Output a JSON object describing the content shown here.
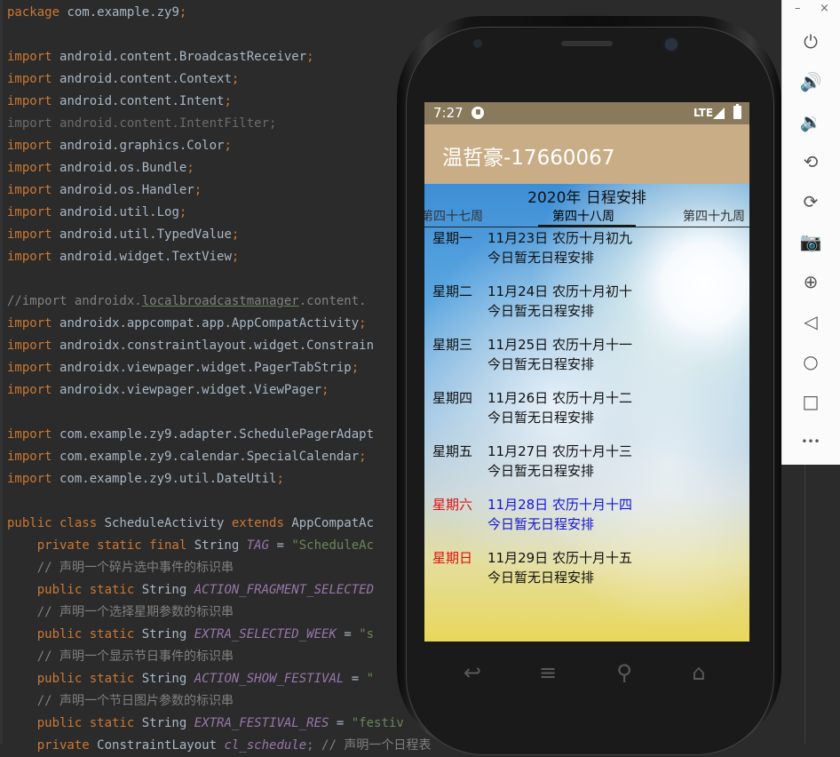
{
  "editor": {
    "lines": [
      [
        {
          "t": "package ",
          "c": "kw"
        },
        {
          "t": "com.example.zy9",
          "c": "typ"
        },
        {
          "t": ";",
          "c": "kw"
        }
      ],
      [],
      [
        {
          "t": "import ",
          "c": "kw"
        },
        {
          "t": "android.content.BroadcastReceiver",
          "c": "typ"
        },
        {
          "t": ";",
          "c": "kw"
        }
      ],
      [
        {
          "t": "import ",
          "c": "kw"
        },
        {
          "t": "android.content.Context",
          "c": "typ"
        },
        {
          "t": ";",
          "c": "kw"
        }
      ],
      [
        {
          "t": "import ",
          "c": "kw"
        },
        {
          "t": "android.content.Intent",
          "c": "typ"
        },
        {
          "t": ";",
          "c": "kw"
        }
      ],
      [
        {
          "t": "import android.content.IntentFilter;",
          "c": "dim"
        }
      ],
      [
        {
          "t": "import ",
          "c": "kw"
        },
        {
          "t": "android.graphics.Color",
          "c": "typ"
        },
        {
          "t": ";",
          "c": "kw"
        }
      ],
      [
        {
          "t": "import ",
          "c": "kw"
        },
        {
          "t": "android.os.Bundle",
          "c": "typ"
        },
        {
          "t": ";",
          "c": "kw"
        }
      ],
      [
        {
          "t": "import ",
          "c": "kw"
        },
        {
          "t": "android.os.Handler",
          "c": "typ"
        },
        {
          "t": ";",
          "c": "kw"
        }
      ],
      [
        {
          "t": "import ",
          "c": "kw"
        },
        {
          "t": "android.util.Log",
          "c": "typ"
        },
        {
          "t": ";",
          "c": "kw"
        }
      ],
      [
        {
          "t": "import ",
          "c": "kw"
        },
        {
          "t": "android.util.TypedValue",
          "c": "typ"
        },
        {
          "t": ";",
          "c": "kw"
        }
      ],
      [
        {
          "t": "import ",
          "c": "kw"
        },
        {
          "t": "android.widget.TextView",
          "c": "typ"
        },
        {
          "t": ";",
          "c": "kw"
        }
      ],
      [],
      [
        {
          "t": "//import androidx.",
          "c": "cmt"
        },
        {
          "t": "localbroadcastmanager",
          "c": "cmt ul"
        },
        {
          "t": ".content.",
          "c": "cmt"
        }
      ],
      [
        {
          "t": "import ",
          "c": "kw"
        },
        {
          "t": "androidx.appcompat.app.AppCompatActivity",
          "c": "typ"
        },
        {
          "t": ";",
          "c": "kw"
        }
      ],
      [
        {
          "t": "import ",
          "c": "kw"
        },
        {
          "t": "androidx.constraintlayout.widget.Constrain",
          "c": "typ"
        }
      ],
      [
        {
          "t": "import ",
          "c": "kw"
        },
        {
          "t": "androidx.viewpager.widget.PagerTabStrip",
          "c": "typ"
        },
        {
          "t": ";",
          "c": "kw"
        }
      ],
      [
        {
          "t": "import ",
          "c": "kw"
        },
        {
          "t": "androidx.viewpager.widget.ViewPager",
          "c": "typ"
        },
        {
          "t": ";",
          "c": "kw"
        }
      ],
      [],
      [
        {
          "t": "import ",
          "c": "kw"
        },
        {
          "t": "com.example.zy9.adapter.SchedulePagerAdapt",
          "c": "typ"
        }
      ],
      [
        {
          "t": "import ",
          "c": "kw"
        },
        {
          "t": "com.example.zy9.calendar.SpecialCalendar",
          "c": "typ"
        },
        {
          "t": ";",
          "c": "kw"
        }
      ],
      [
        {
          "t": "import ",
          "c": "kw"
        },
        {
          "t": "com.example.zy9.util.DateUtil",
          "c": "typ"
        },
        {
          "t": ";",
          "c": "kw"
        }
      ],
      [],
      [
        {
          "t": "public class ",
          "c": "kw"
        },
        {
          "t": "ScheduleActivity ",
          "c": "typ"
        },
        {
          "t": "extends ",
          "c": "kw"
        },
        {
          "t": "AppCompatAc",
          "c": "typ"
        }
      ],
      [
        {
          "t": "    private static final ",
          "c": "kw"
        },
        {
          "t": "String ",
          "c": "typ"
        },
        {
          "t": "TAG",
          "c": "fld"
        },
        {
          "t": " = ",
          "c": "typ"
        },
        {
          "t": "\"ScheduleAc",
          "c": "str"
        }
      ],
      [
        {
          "t": "    // 声明一个碎片选中事件的标识串",
          "c": "cmt"
        }
      ],
      [
        {
          "t": "    public static ",
          "c": "kw"
        },
        {
          "t": "String ",
          "c": "typ"
        },
        {
          "t": "ACTION_FRAGMENT_SELECTED",
          "c": "fld"
        },
        {
          "t": "                                   ",
          "c": "typ"
        },
        {
          "t": "\";",
          "c": "kw"
        }
      ],
      [
        {
          "t": "    // 声明一个选择星期参数的标识串",
          "c": "cmt"
        }
      ],
      [
        {
          "t": "    public static ",
          "c": "kw"
        },
        {
          "t": "String ",
          "c": "typ"
        },
        {
          "t": "EXTRA_SELECTED_WEEK",
          "c": "fld"
        },
        {
          "t": " = ",
          "c": "typ"
        },
        {
          "t": "\"s",
          "c": "str"
        }
      ],
      [
        {
          "t": "    // 声明一个显示节日事件的标识串",
          "c": "cmt"
        }
      ],
      [
        {
          "t": "    public static ",
          "c": "kw"
        },
        {
          "t": "String ",
          "c": "typ"
        },
        {
          "t": "ACTION_SHOW_FESTIVAL",
          "c": "fld"
        },
        {
          "t": " = ",
          "c": "typ"
        },
        {
          "t": "\"",
          "c": "str"
        }
      ],
      [
        {
          "t": "    // 声明一个节日图片参数的标识串",
          "c": "cmt"
        }
      ],
      [
        {
          "t": "    public static ",
          "c": "kw"
        },
        {
          "t": "String ",
          "c": "typ"
        },
        {
          "t": "EXTRA_FESTIVAL_RES",
          "c": "fld"
        },
        {
          "t": " = ",
          "c": "typ"
        },
        {
          "t": "\"festiv",
          "c": "str"
        }
      ],
      [
        {
          "t": "    private ",
          "c": "kw"
        },
        {
          "t": "ConstraintLayout ",
          "c": "typ"
        },
        {
          "t": "cl_schedule",
          "c": "fld"
        },
        {
          "t": "; // 声明一个日程表",
          "c": "cmt"
        }
      ]
    ]
  },
  "phone": {
    "status": {
      "time": "7:27",
      "network": "LTE"
    },
    "app_title": "温哲豪-17660067",
    "page_title": "2020年 日程安排",
    "tabs": {
      "prev": "第四十七周",
      "current": "第四十八周",
      "next": "第四十九周"
    },
    "days": [
      {
        "weekday": "星期一",
        "date": "11月23日 农历十月初九",
        "schedule": "今日暂无日程安排",
        "weekday_color": "",
        "date_color": ""
      },
      {
        "weekday": "星期二",
        "date": "11月24日 农历十月初十",
        "schedule": "今日暂无日程安排",
        "weekday_color": "",
        "date_color": ""
      },
      {
        "weekday": "星期三",
        "date": "11月25日 农历十月十一",
        "schedule": "今日暂无日程安排",
        "weekday_color": "",
        "date_color": ""
      },
      {
        "weekday": "星期四",
        "date": "11月26日 农历十月十二",
        "schedule": "今日暂无日程安排",
        "weekday_color": "",
        "date_color": ""
      },
      {
        "weekday": "星期五",
        "date": "11月27日 农历十月十三",
        "schedule": "今日暂无日程安排",
        "weekday_color": "",
        "date_color": ""
      },
      {
        "weekday": "星期六",
        "date": "11月28日 农历十月十四",
        "schedule": "今日暂无日程安排",
        "weekday_color": "red",
        "date_color": "blue"
      },
      {
        "weekday": "星期日",
        "date": "11月29日 农历十月十五",
        "schedule": "今日暂无日程安排",
        "weekday_color": "red",
        "date_color": ""
      }
    ],
    "colors": {
      "status_bar": "#8a7a5d",
      "app_bar": "#c9ad86",
      "weekend_red": "#e01010",
      "saturday_blue": "#1515d8"
    }
  },
  "toolbar": {
    "minimize": "–",
    "close": "×",
    "buttons": [
      {
        "icon": "power-icon",
        "glyph": "⏻"
      },
      {
        "icon": "volume-up-icon",
        "glyph": "🔊"
      },
      {
        "icon": "volume-down-icon",
        "glyph": "🔉"
      },
      {
        "icon": "rotate-left-icon",
        "glyph": "⟲"
      },
      {
        "icon": "rotate-right-icon",
        "glyph": "⟳"
      },
      {
        "icon": "camera-icon",
        "glyph": "📷"
      },
      {
        "icon": "zoom-icon",
        "glyph": "⊕"
      },
      {
        "icon": "back-icon",
        "glyph": "◁"
      },
      {
        "icon": "home-icon",
        "glyph": "○"
      },
      {
        "icon": "overview-icon",
        "glyph": "□"
      },
      {
        "icon": "more-icon",
        "glyph": "•••"
      }
    ]
  },
  "nav_keys": [
    {
      "icon": "back-key-icon",
      "glyph": "↩"
    },
    {
      "icon": "menu-key-icon",
      "glyph": "≡"
    },
    {
      "icon": "search-key-icon",
      "glyph": "⚲"
    },
    {
      "icon": "home-key-icon",
      "glyph": "⌂"
    }
  ]
}
